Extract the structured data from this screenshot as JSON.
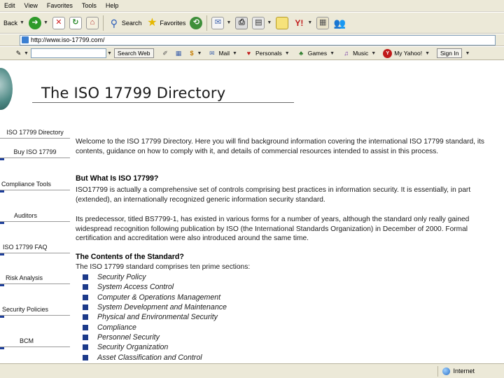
{
  "menu": [
    "Edit",
    "View",
    "Favorites",
    "Tools",
    "Help"
  ],
  "toolbar": {
    "back_label": "Back",
    "search_label": "Search",
    "favorites_label": "Favorites"
  },
  "address": {
    "url": "http://www.iso-17799.com/"
  },
  "links_bar": {
    "search_button": "Search Web",
    "mail": "Mail",
    "personals": "Personals",
    "games": "Games",
    "music": "Music",
    "my_yahoo": "My Yahoo!",
    "sign_in": "Sign In"
  },
  "page": {
    "title": "The ISO 17799 Directory",
    "nav": [
      "ISO 17799 Directory",
      "Buy ISO 17799",
      "Compliance Tools",
      "Auditors",
      "ISO 17799 FAQ",
      "Risk Analysis",
      "Security Policies",
      "BCM"
    ],
    "intro": "Welcome to the ISO 17799 Directory. Here you will find background information covering the international ISO 17799 standard, its contents, guidance on how to comply with it, and details of commercial resources intended to assist in this process.",
    "what_heading": "But What Is ISO 17799?",
    "what_text": "ISO17799 is actually a comprehensive set of controls comprising best practices in information security. It is essentially, in part (extended), an internationally recognized generic information security standard.",
    "predecessor_text": "Its predecessor, titled BS7799-1, has existed in various forms for a number of years, although the standard only really gained widespread recognition following publication by ISO (the International Standards Organization) in December of 2000. Formal certification and accreditation were also introduced around the same time.",
    "contents_heading": "The Contents of the Standard?",
    "contents_intro": "The ISO 17799 standard comprises ten prime sections:",
    "sections": [
      "Security Policy",
      "System Access Control",
      "Computer & Operations Management",
      "System Development and Maintenance",
      "Physical and Environmental Security",
      "Compliance",
      "Personnel Security",
      "Security Organization",
      "Asset Classification and Control"
    ]
  },
  "status": {
    "zone": "Internet"
  },
  "colors": {
    "chrome": "#ece9d8",
    "bullet": "#1c3a8a",
    "nav_tick": "#1e3f9a"
  }
}
